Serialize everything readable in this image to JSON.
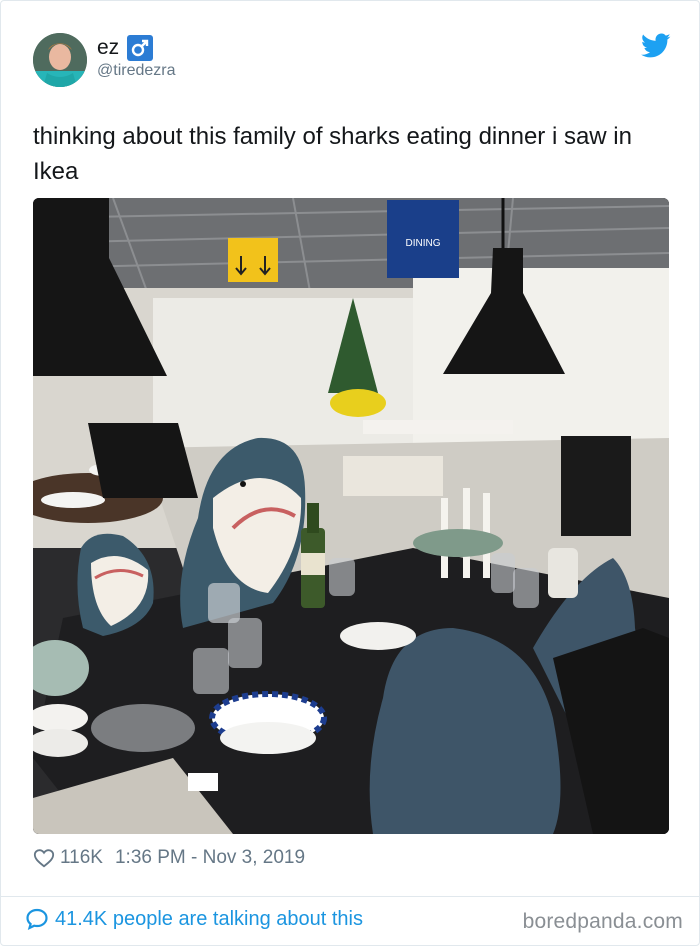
{
  "user": {
    "display_name": "ez",
    "handle": "@tiredezra",
    "badge_icon": "male-sign-icon",
    "badge_color": "#2c7cd4"
  },
  "tweet": {
    "text": "thinking about this family of sharks eating dinner i saw in Ikea"
  },
  "photo": {
    "sign_text": "DINING",
    "description_icon": "ikea-shark-dinner-photo"
  },
  "meta": {
    "likes": "116K",
    "timestamp": "1:36 PM - Nov 3, 2019"
  },
  "footer": {
    "talking": "41.4K people are talking about this",
    "watermark": "boredpanda.com"
  },
  "colors": {
    "twitter_blue": "#1da1f2",
    "link_blue": "#1b95e0",
    "secondary_text": "#657786"
  }
}
